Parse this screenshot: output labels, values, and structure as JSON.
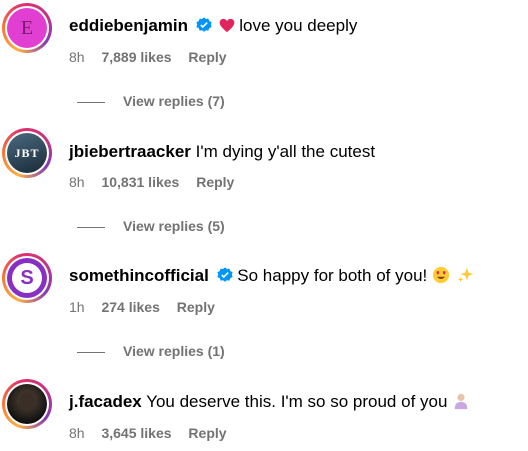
{
  "comments": [
    {
      "username": "eddiebenjamin",
      "verified": true,
      "text": "love you deeply",
      "time": "8h",
      "likes": "7,889 likes",
      "reply": "Reply",
      "view_replies": "View replies (7)",
      "avatar_letter": "E"
    },
    {
      "username": "jbiebertraacker",
      "verified": false,
      "text": "I'm dying y'all the cutest",
      "time": "8h",
      "likes": "10,831 likes",
      "reply": "Reply",
      "view_replies": "View replies (5)",
      "avatar_letter": "JBT"
    },
    {
      "username": "somethincofficial",
      "verified": true,
      "text": "So happy for both of you!",
      "time": "1h",
      "likes": "274 likes",
      "reply": "Reply",
      "view_replies": "View replies (1)",
      "avatar_letter": "S"
    },
    {
      "username": "j.facadex",
      "verified": false,
      "text": "You deserve this. I'm so so proud of you",
      "time": "8h",
      "likes": "3,645 likes",
      "reply": "Reply"
    }
  ]
}
